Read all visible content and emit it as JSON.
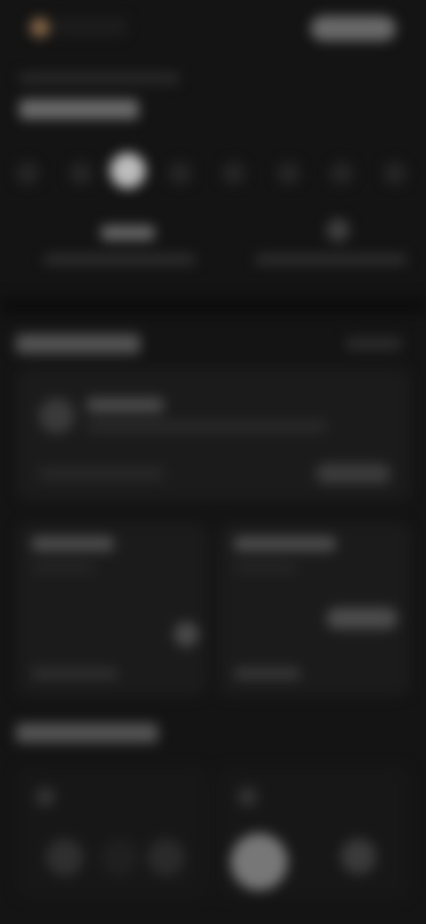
{
  "header": {
    "app_name": "",
    "action_label": ""
  },
  "greeting": {
    "small": "",
    "title": ""
  },
  "days": [
    "",
    "",
    "",
    "",
    "",
    "",
    "",
    ""
  ],
  "summary": [
    {
      "value": "",
      "label": ""
    },
    {
      "value": "",
      "label": ""
    }
  ],
  "activity": {
    "section_title": "",
    "section_link": "",
    "title": "",
    "subtitle": "",
    "footer": "",
    "button": ""
  },
  "mini_cards": [
    {
      "title": "",
      "subtitle": "",
      "footer": ""
    },
    {
      "title": "",
      "subtitle": "",
      "chip": "",
      "footer": ""
    }
  ],
  "section2_title": ""
}
